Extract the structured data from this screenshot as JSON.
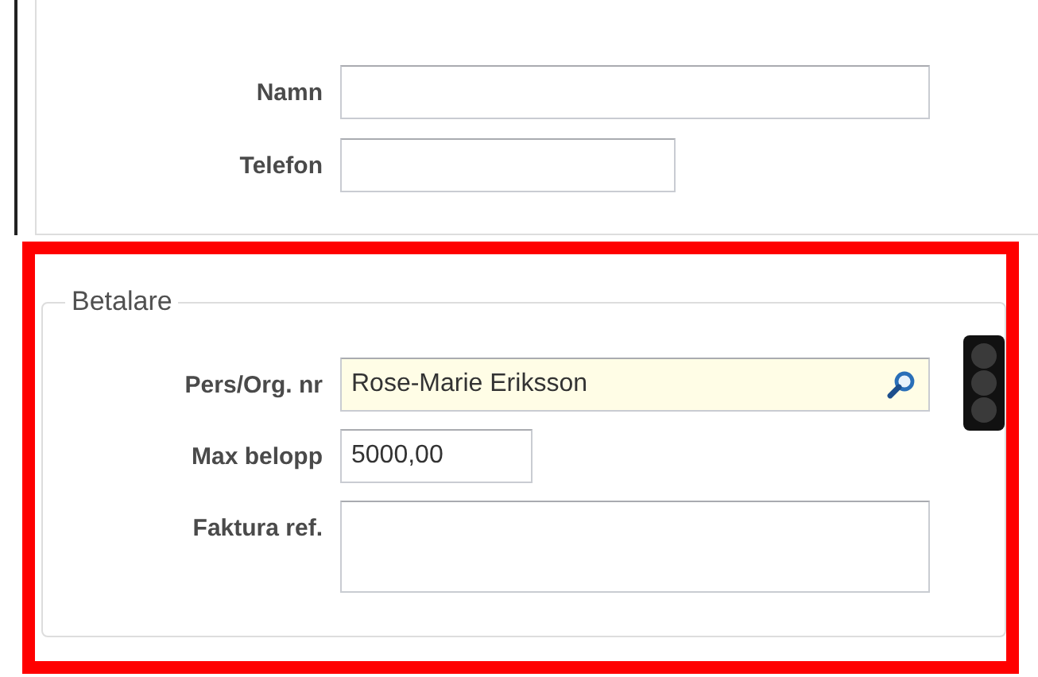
{
  "contact_section": {
    "fields": [
      {
        "label": "Namn",
        "kind": "wide"
      },
      {
        "label": "Telefon",
        "kind": "short"
      }
    ]
  },
  "payer_section": {
    "legend": "Betalare",
    "highlighted": true,
    "fields": [
      {
        "label": "Pers/Org. nr",
        "value": "Rose-Marie Eriksson",
        "kind": "search"
      },
      {
        "label": "Max belopp",
        "value": "5000,00",
        "kind": "short"
      },
      {
        "label": "Faktura ref.",
        "kind": "multiline"
      }
    ]
  }
}
